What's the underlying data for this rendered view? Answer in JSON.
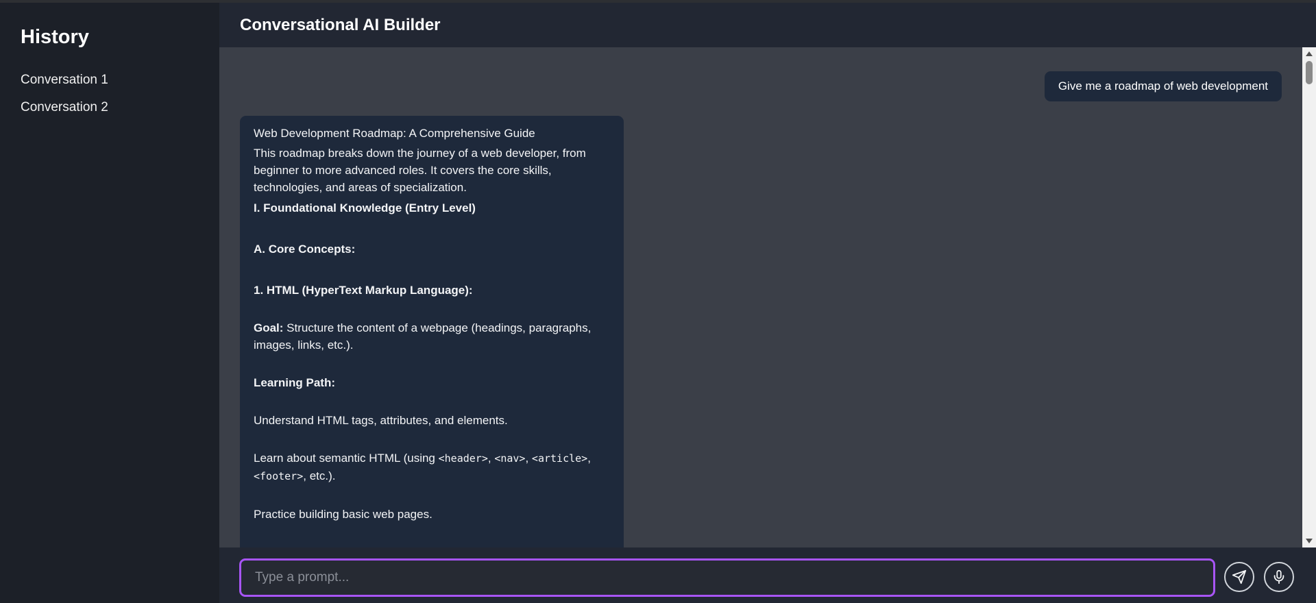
{
  "sidebar": {
    "title": "History",
    "items": [
      {
        "label": "Conversation 1"
      },
      {
        "label": "Conversation 2"
      }
    ]
  },
  "header": {
    "title": "Conversational AI Builder"
  },
  "chat": {
    "user_message": "Give me a roadmap of web development",
    "bot": {
      "title": "Web Development Roadmap: A Comprehensive Guide",
      "intro": "This roadmap breaks down the journey of a web developer, from beginner to more advanced roles. It covers the core skills, technologies, and areas of specialization.",
      "section_1": "I. Foundational Knowledge (Entry Level)",
      "subsection_a": "A. Core Concepts:",
      "item_1": "1. HTML (HyperText Markup Language):",
      "goal_label": "Goal:",
      "goal_text": " Structure the content of a webpage (headings, paragraphs, images, links, etc.).",
      "learning_path_label": "Learning Path:",
      "lp_1": "Understand HTML tags, attributes, and elements.",
      "lp_2_prefix": "Learn about semantic HTML (using ",
      "lp_2_code_1": "<header>",
      "lp_2_sep_1": ", ",
      "lp_2_code_2": "<nav>",
      "lp_2_sep_2": ", ",
      "lp_2_code_3": "<article>",
      "lp_2_sep_3": ", ",
      "lp_2_code_4": "<footer>",
      "lp_2_suffix": ", etc.).",
      "lp_3": "Practice building basic web pages."
    }
  },
  "input": {
    "placeholder": "Type a prompt...",
    "value": ""
  },
  "icons": {
    "send": "send-icon",
    "mic": "microphone-icon"
  },
  "colors": {
    "sidebar_bg": "#1c2028",
    "header_bg": "#222733",
    "chat_bg": "#3b3f48",
    "bubble_bg": "#1e293b",
    "input_accent": "#a855f7"
  }
}
